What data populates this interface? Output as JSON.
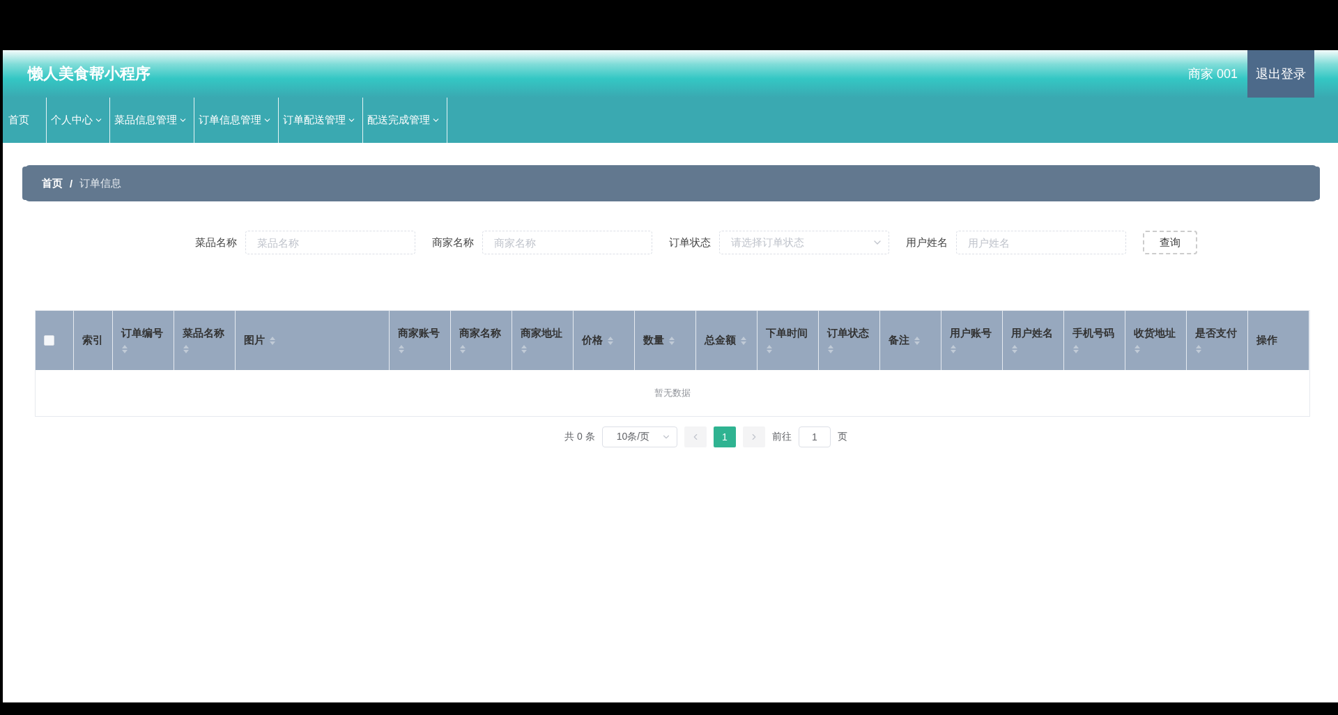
{
  "header": {
    "title": "懒人美食帮小程序",
    "user": "商家 001",
    "logout": "退出登录"
  },
  "nav": [
    {
      "label": "首页",
      "dropdown": false
    },
    {
      "label": "个人中心",
      "dropdown": true
    },
    {
      "label": "菜品信息管理",
      "dropdown": true
    },
    {
      "label": "订单信息管理",
      "dropdown": true
    },
    {
      "label": "订单配送管理",
      "dropdown": true
    },
    {
      "label": "配送完成管理",
      "dropdown": true
    }
  ],
  "breadcrumb": [
    "首页",
    "订单信息"
  ],
  "breadcrumb_separator": "/",
  "search": [
    {
      "kind": "input",
      "label": "菜品名称",
      "placeholder": "菜品名称"
    },
    {
      "kind": "input",
      "label": "商家名称",
      "placeholder": "商家名称"
    },
    {
      "kind": "select",
      "label": "订单状态",
      "placeholder": "请选择订单状态"
    },
    {
      "kind": "input",
      "label": "用户姓名",
      "placeholder": "用户姓名"
    }
  ],
  "search_button": "查询",
  "table": {
    "select_all": {
      "checked": false
    },
    "columns": [
      {
        "label": "索引",
        "sortable": false,
        "wide": false
      },
      {
        "label": "订单编号",
        "sortable": true,
        "wide": false
      },
      {
        "label": "菜品名称",
        "sortable": true,
        "wide": false
      },
      {
        "label": "图片",
        "sortable": true,
        "wide": true
      },
      {
        "label": "商家账号",
        "sortable": true,
        "wide": false
      },
      {
        "label": "商家名称",
        "sortable": true,
        "wide": false
      },
      {
        "label": "商家地址",
        "sortable": true,
        "wide": false
      },
      {
        "label": "价格",
        "sortable": true,
        "wide": false
      },
      {
        "label": "数量",
        "sortable": true,
        "wide": false
      },
      {
        "label": "总金额",
        "sortable": true,
        "wide": false
      },
      {
        "label": "下单时间",
        "sortable": true,
        "wide": false
      },
      {
        "label": "订单状态",
        "sortable": true,
        "wide": false
      },
      {
        "label": "备注",
        "sortable": true,
        "wide": false
      },
      {
        "label": "用户账号",
        "sortable": true,
        "wide": false
      },
      {
        "label": "用户姓名",
        "sortable": true,
        "wide": false
      },
      {
        "label": "手机号码",
        "sortable": true,
        "wide": false
      },
      {
        "label": "收货地址",
        "sortable": true,
        "wide": false
      },
      {
        "label": "是否支付",
        "sortable": true,
        "wide": false
      },
      {
        "label": "操作",
        "sortable": false,
        "wide": false
      }
    ],
    "empty_text": "暂无数据"
  },
  "pagination": {
    "total": "共 0 条",
    "page_size": "10条/页",
    "pages": [
      {
        "label": "1",
        "selected": true
      }
    ],
    "goto_label": "前往",
    "goto_value": "1",
    "goto_suffix": "页"
  }
}
